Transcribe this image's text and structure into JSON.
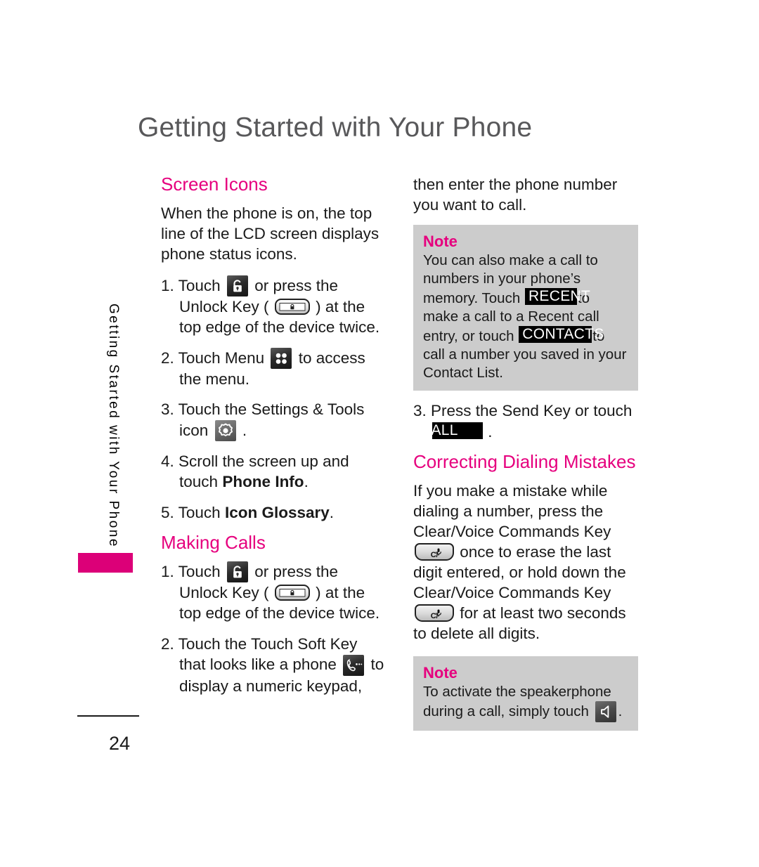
{
  "page": {
    "title": "Getting Started with Your Phone",
    "side_tab_text": "Getting Started with Your Phone",
    "number": "24"
  },
  "colors": {
    "accent_magenta": "#e6007e",
    "side_tab_magenta": "#dc0078",
    "title_grey": "#58585a",
    "note_background": "#cccccc",
    "key_label_background": "#000000",
    "body_text": "#1a1a1a"
  },
  "left_column": {
    "section_screen_icons": {
      "heading": "Screen Icons",
      "intro": "When the phone is on, the top line of the LCD screen displays phone status icons.",
      "steps": [
        {
          "number": "1.",
          "part1": "Touch",
          "part2": "or press the Unlock Key (",
          "part3": ") at the top edge of the device twice.",
          "icon1": "lock-icon",
          "icon2": "unlock-hardware-key-icon"
        },
        {
          "number": "2.",
          "part1": "Touch Menu",
          "part2": "to access the menu.",
          "icon1": "menu-grid-icon"
        },
        {
          "number": "3.",
          "part1": "Touch the Settings & Tools icon",
          "part2": ".",
          "icon1": "settings-gear-icon"
        },
        {
          "number": "4.",
          "part1": "Scroll the screen up and touch",
          "bold": "Phone Info",
          "part2": "."
        },
        {
          "number": "5.",
          "part1": "Touch",
          "bold": "Icon Glossary",
          "part2": "."
        }
      ]
    },
    "section_making_calls": {
      "heading": "Making Calls",
      "steps": [
        {
          "number": "1.",
          "part1": "Touch",
          "part2": "or press the Unlock Key (",
          "part3": ") at the top edge of the device twice.",
          "icon1": "lock-icon",
          "icon2": "unlock-hardware-key-icon"
        },
        {
          "number": "2.",
          "part1": "Touch the Touch Soft Key that looks like a phone",
          "part2": "to display a numeric keypad,",
          "icon1": "phone-handset-icon"
        }
      ]
    }
  },
  "right_column": {
    "continuation": "then enter the phone number you want to call.",
    "note_1": {
      "title": "Note",
      "line1": "You can also make a call to numbers in your phone’s memory. Touch",
      "key_recent": "RECENT",
      "line2": "to make a call to a Recent call entry, or touch",
      "key_contacts": "CONTACTS",
      "line3": "to call a number you saved in your Contact List."
    },
    "step_3": {
      "number": "3.",
      "part1": "Press the Send Key or touch",
      "key_call": "CALL",
      "part2": "."
    },
    "section_correcting": {
      "heading": "Correcting Dialing Mistakes",
      "part1": "If you make a mistake while dialing a number, press  the Clear/Voice Commands Key",
      "part2": "once to erase the last digit entered, or hold down the Clear/Voice Commands Key",
      "part3": "for at least two seconds to delete all digits.",
      "clear_key_label": "C/",
      "icon": "clear-voice-commands-key-icon"
    },
    "note_2": {
      "title": "Note",
      "line1": "To activate the speakerphone during a call, simply touch",
      "line2": ".",
      "icon": "speakerphone-icon"
    }
  }
}
